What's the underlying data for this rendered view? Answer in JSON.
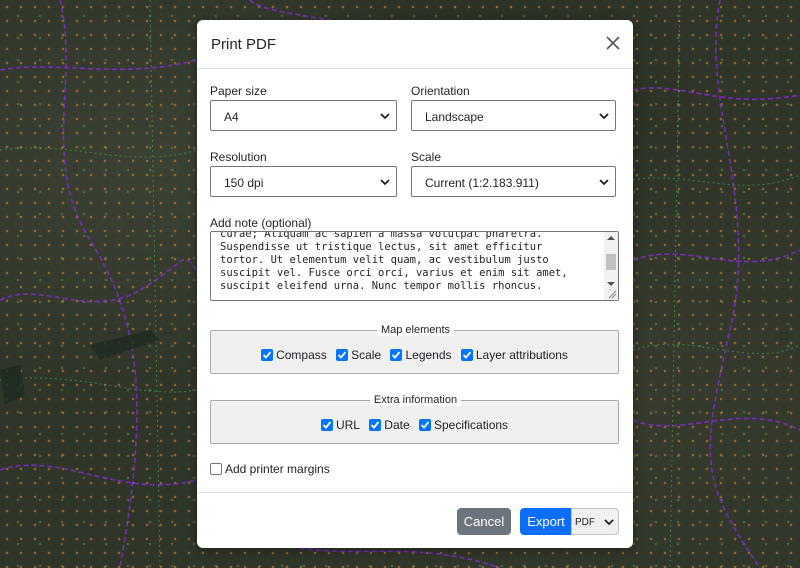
{
  "colors": {
    "accent": "#0d6efd",
    "checkbox": "#0075ff",
    "cancel": "#6c757d",
    "map_route": "#8a2be2",
    "map_points": "#d68a34"
  },
  "dialog": {
    "title": "Print PDF",
    "close_icon": "close-icon"
  },
  "form": {
    "paper_size": {
      "label": "Paper size",
      "value": "A4"
    },
    "orientation": {
      "label": "Orientation",
      "value": "Landscape"
    },
    "resolution": {
      "label": "Resolution",
      "value": "150 dpi"
    },
    "scale": {
      "label": "Scale",
      "value": "Current (1:2.183.911)"
    },
    "note": {
      "label": "Add note (optional)",
      "value": "curae; Aliquam ac sapien a massa volutpat pharetra.\nSuspendisse ut tristique lectus, sit amet efficitur\ntortor. Ut elementum velit quam, ac vestibulum justo\nsuscipit vel. Fusce orci orci, varius et enim sit amet,\nsuscipit eleifend urna. Nunc tempor mollis rhoncus."
    },
    "map_elements": {
      "legend": "Map elements",
      "items": [
        {
          "label": "Compass",
          "checked": true
        },
        {
          "label": "Scale",
          "checked": true
        },
        {
          "label": "Legends",
          "checked": true
        },
        {
          "label": "Layer attributions",
          "checked": true
        }
      ]
    },
    "extra_information": {
      "legend": "Extra information",
      "items": [
        {
          "label": "URL",
          "checked": true
        },
        {
          "label": "Date",
          "checked": true
        },
        {
          "label": "Specifications",
          "checked": true
        }
      ]
    },
    "printer_margins": {
      "label": "Add printer margins",
      "checked": false
    }
  },
  "footer": {
    "cancel_label": "Cancel",
    "export_label": "Export",
    "format_value": "PDF"
  }
}
